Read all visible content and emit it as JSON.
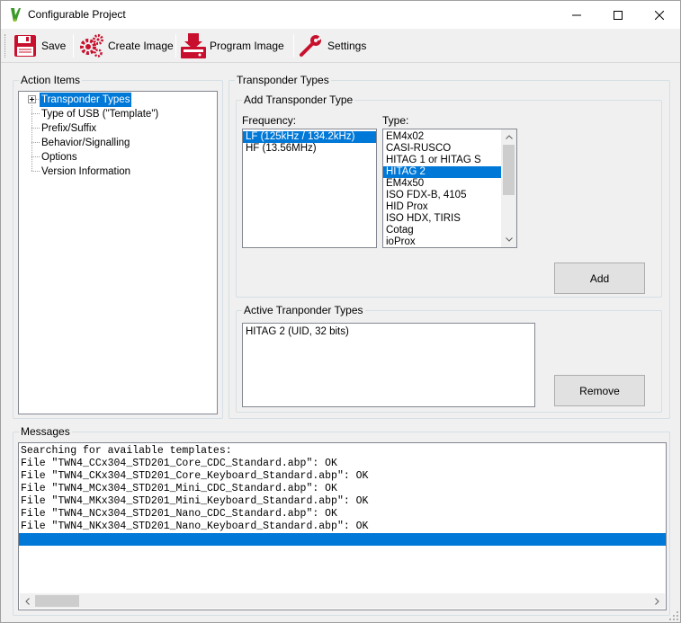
{
  "window": {
    "title": "Configurable Project"
  },
  "toolbar": {
    "buttons": [
      {
        "label": "Save",
        "icon": "floppy-disk-icon"
      },
      {
        "label": "Create Image",
        "icon": "gears-icon"
      },
      {
        "label": "Program Image",
        "icon": "download-to-device-icon"
      },
      {
        "label": "Settings",
        "icon": "wrench-icon"
      }
    ]
  },
  "action_items": {
    "title": "Action Items",
    "items": [
      "Transponder Types",
      "Type of USB (\"Template\")",
      "Prefix/Suffix",
      "Behavior/Signalling",
      "Options",
      "Version Information"
    ],
    "selected_index": 0
  },
  "transponder_types": {
    "title": "Transponder Types",
    "add_group": {
      "title": "Add Transponder Type",
      "frequency_label": "Frequency:",
      "frequencies": [
        "LF (125kHz / 134.2kHz)",
        "HF (13.56MHz)"
      ],
      "selected_frequency_index": 0,
      "type_label": "Type:",
      "types": [
        "EM4x02",
        "CASI-RUSCO",
        "HITAG 1 or HITAG S",
        "HITAG 2",
        "EM4x50",
        "ISO FDX-B, 4105",
        "HID Prox",
        "ISO HDX, TIRIS",
        "Cotag",
        "ioProx"
      ],
      "selected_type_index": 3,
      "add_button": "Add"
    },
    "active_group": {
      "title": "Active Tranponder Types",
      "items": [
        "HITAG 2 (UID, 32 bits)"
      ],
      "remove_button": "Remove"
    }
  },
  "messages": {
    "title": "Messages",
    "lines": [
      "Searching for available templates:",
      "File \"TWN4_CCx304_STD201_Core_CDC_Standard.abp\": OK",
      "File \"TWN4_CKx304_STD201_Core_Keyboard_Standard.abp\": OK",
      "File \"TWN4_MCx304_STD201_Mini_CDC_Standard.abp\": OK",
      "File \"TWN4_MKx304_STD201_Mini_Keyboard_Standard.abp\": OK",
      "File \"TWN4_NCx304_STD201_Nano_CDC_Standard.abp\": OK",
      "File \"TWN4_NKx304_STD201_Nano_Keyboard_Standard.abp\": OK",
      ""
    ],
    "selected_index": 7
  },
  "colors": {
    "selection": "#0078d7",
    "window_bg": "#f0f0f0",
    "title_bar": "#ffffff"
  }
}
